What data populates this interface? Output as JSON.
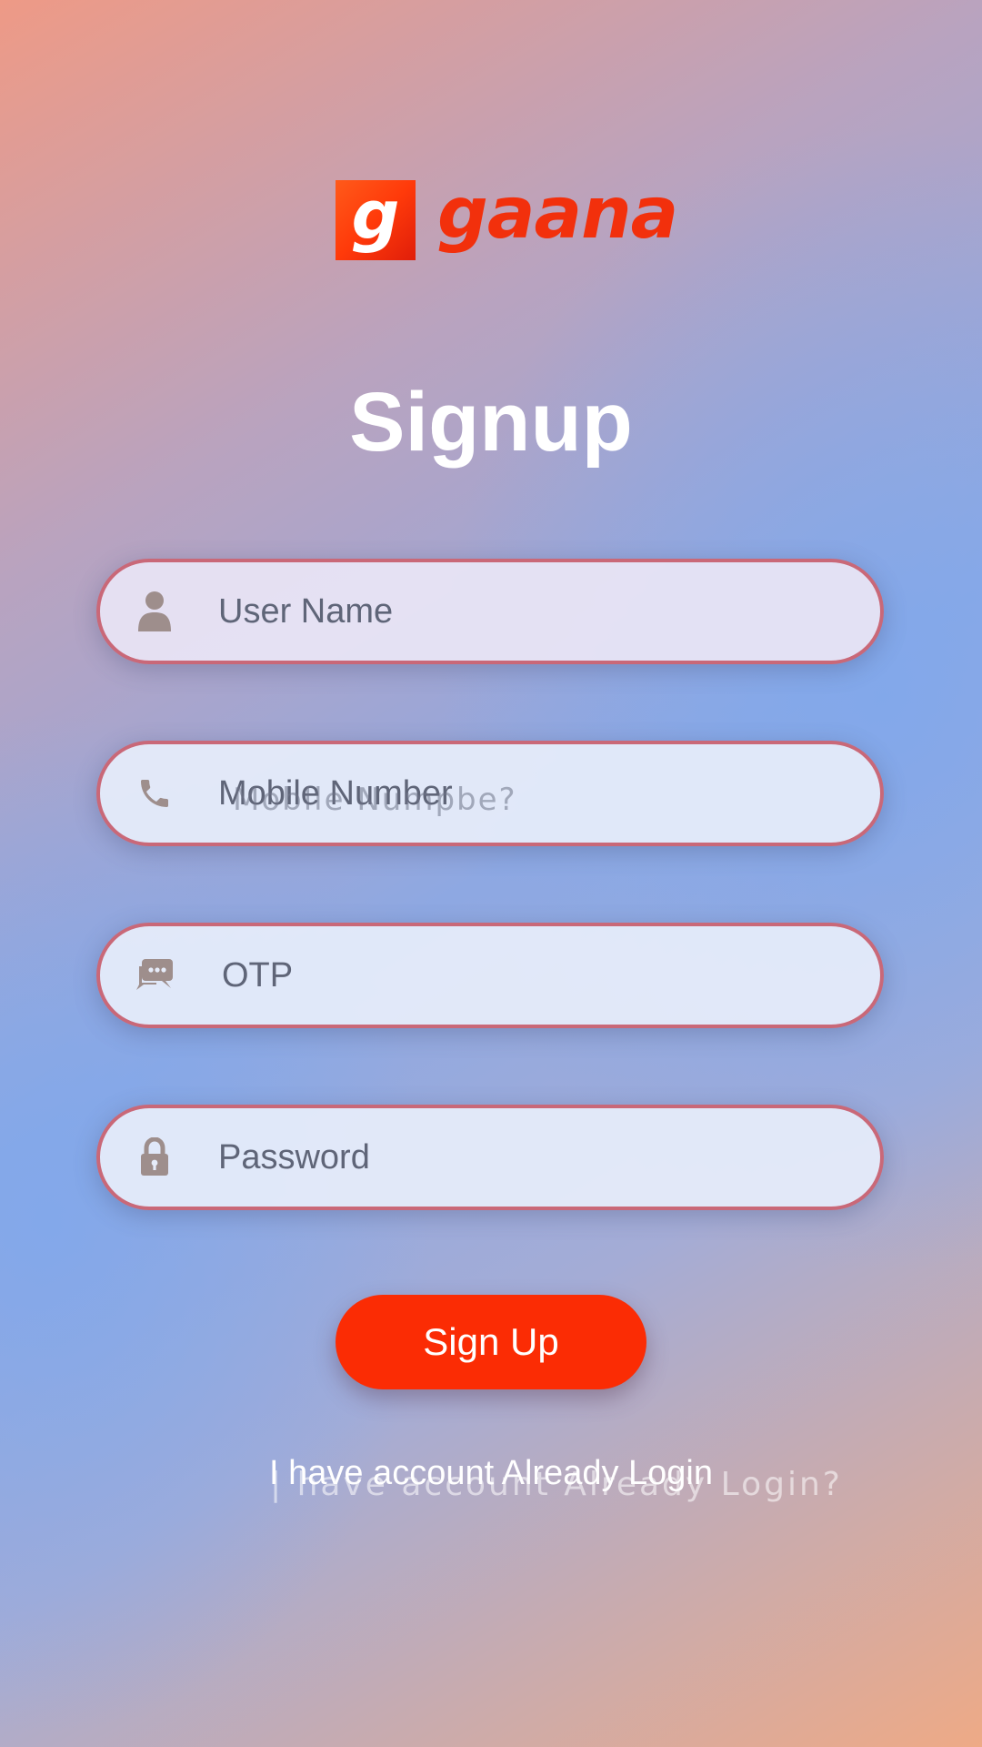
{
  "logo": {
    "mark": "g",
    "wordmark": "gaana"
  },
  "title": "Signup",
  "fields": {
    "username": {
      "placeholder": "User Name",
      "icon": "person-icon"
    },
    "mobile": {
      "placeholder": "Mobile Number",
      "ghost_hint": "Moblle Numpbe?",
      "icon": "phone-icon"
    },
    "otp": {
      "placeholder": "OTP",
      "icon": "chat-icon"
    },
    "password": {
      "placeholder": "Password",
      "icon": "lock-icon"
    }
  },
  "signup_button": {
    "label": "Sign Up"
  },
  "login_link": {
    "label": "I have account Already Login",
    "ghost": "| have account Already Login?"
  },
  "colors": {
    "accent": "#fb2c04",
    "field_border": "#c96878",
    "icon": "#9e8e8c",
    "title": "#ffffff"
  }
}
